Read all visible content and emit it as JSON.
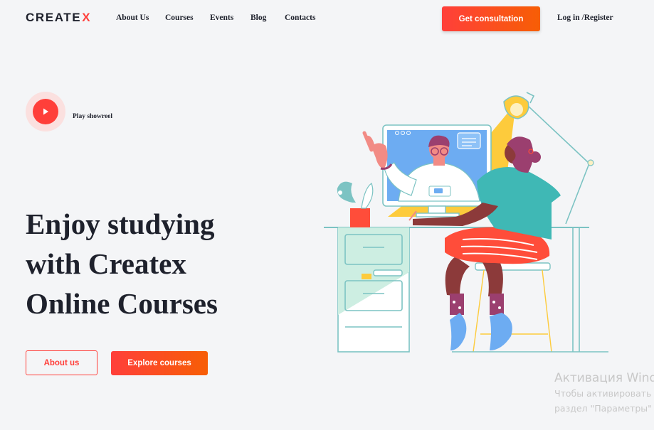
{
  "header": {
    "logo_text": "CREATE",
    "logo_x": "X",
    "nav": [
      "About Us",
      "Courses",
      "Events",
      "Blog",
      "Contacts"
    ],
    "consult_label": "Get consultation",
    "login_label": "Log in /Register"
  },
  "showreel": {
    "label": "Play showreel",
    "icon": "play-icon"
  },
  "hero": {
    "title_lines": [
      "Enjoy studying",
      "with Createx",
      "Online Courses"
    ],
    "about_label": "About us",
    "explore_label": "Explore courses"
  },
  "watermark": {
    "title": "Активация Wind",
    "line1": "Чтобы активировать",
    "line2": "раздел \"Параметры\""
  },
  "colors": {
    "accent": "#ff3f3a",
    "accent_end": "#f75e05",
    "text": "#1e212c",
    "background": "#f4f5f7"
  }
}
